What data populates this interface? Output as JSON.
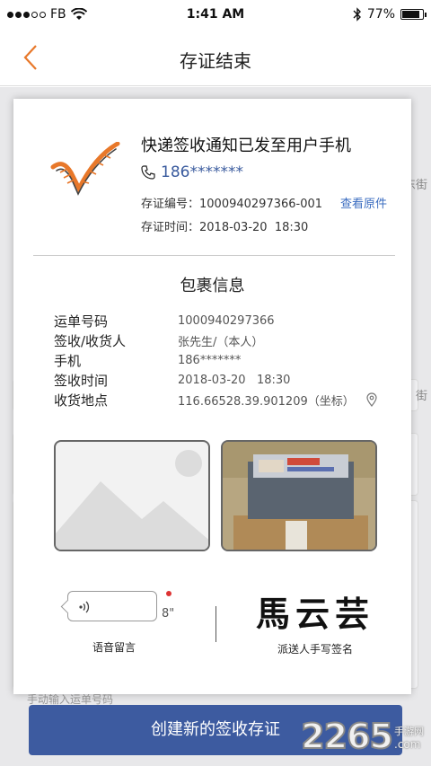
{
  "status_bar": {
    "carrier": "FB",
    "time": "1:41 AM",
    "battery": "77%",
    "battery_level": 0.77
  },
  "navbar": {
    "title": "存证结束"
  },
  "notice": {
    "title": "快递签收通知已发至用户手机",
    "phone": "186*******",
    "cert_no_label": "存证编号：",
    "cert_no": "1000940297366-001",
    "view_original": "查看原件",
    "cert_time_label": "存证时间：",
    "cert_time": "2018-03-20  18:30"
  },
  "package": {
    "title": "包裹信息",
    "rows": [
      {
        "label": "运单号码",
        "value": "1000940297366"
      },
      {
        "label": "签收/收货人",
        "value": "张先生/（本人）"
      },
      {
        "label": "手机",
        "value": "186*******"
      },
      {
        "label": "签收时间",
        "value": "2018-03-20   18:30"
      },
      {
        "label": "收货地点",
        "value": "116.66528.39.901209（坐标）"
      }
    ]
  },
  "voice": {
    "duration": "8\"",
    "label": "语音留言"
  },
  "signature": {
    "text": "馬云芸",
    "label": "派送人手写签名"
  },
  "background": {
    "hint": "手动输入运单号码",
    "side_text_1": "东街",
    "side_text_2": "街"
  },
  "create_button": "创建新的签收存证",
  "watermark": {
    "number": "2265",
    "suffix": ".com",
    "text": "手游网"
  },
  "colors": {
    "accent": "#e8782a",
    "button": "#3d5ba0",
    "link": "#3a6cc0"
  }
}
